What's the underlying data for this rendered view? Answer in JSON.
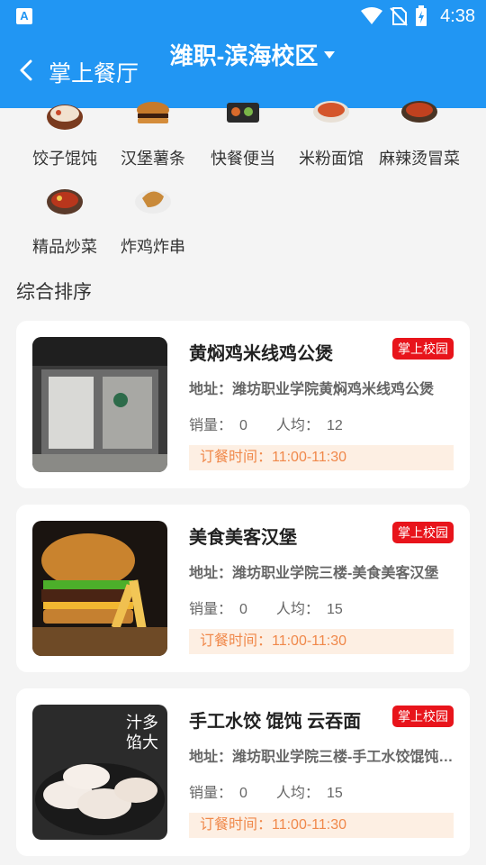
{
  "status_bar": {
    "time": "4:38",
    "app_icon_letter": "A"
  },
  "app_bar": {
    "title": "掌上餐厅",
    "campus": "潍职-滨海校区"
  },
  "categories": [
    {
      "label": "饺子馄饨",
      "icon": "dumpling-icon"
    },
    {
      "label": "汉堡薯条",
      "icon": "burger-icon"
    },
    {
      "label": "快餐便当",
      "icon": "bento-icon"
    },
    {
      "label": "米粉面馆",
      "icon": "noodle-icon"
    },
    {
      "label": "麻辣烫冒菜",
      "icon": "hotpot-icon"
    },
    {
      "label": "精品炒菜",
      "icon": "stirfry-icon"
    },
    {
      "label": "炸鸡炸串",
      "icon": "fried-chicken-icon"
    }
  ],
  "section_title": "综合排序",
  "stores": [
    {
      "name": "黄焖鸡米线鸡公煲",
      "tag": "掌上校园",
      "address": "地址：潍坊职业学院黄焖鸡米线鸡公煲",
      "sales_label": "销量：",
      "sales": "0",
      "avg_label": "人均：",
      "avg": "12",
      "order_time": "订餐时间：11:00-11:30",
      "photo": "storefront-photo"
    },
    {
      "name": "美食美客汉堡",
      "tag": "掌上校园",
      "address": "地址：潍坊职业学院三楼-美食美客汉堡",
      "sales_label": "销量：",
      "sales": "0",
      "avg_label": "人均：",
      "avg": "15",
      "order_time": "订餐时间：11:00-11:30",
      "photo": "burger-photo"
    },
    {
      "name": "手工水饺 馄饨 云吞面",
      "tag": "掌上校园",
      "address": "地址：潍坊职业学院三楼-手工水饺馄饨云吞面",
      "sales_label": "销量：",
      "sales": "0",
      "avg_label": "人均：",
      "avg": "15",
      "order_time": "订餐时间：11:00-11:30",
      "photo": "dumpling-photo",
      "photo_text": "汁多馅大"
    }
  ],
  "colors": {
    "primary": "#2196f3",
    "tag_red": "#e8141b",
    "order_bg": "#fdefe3",
    "order_text": "#f0884a"
  }
}
